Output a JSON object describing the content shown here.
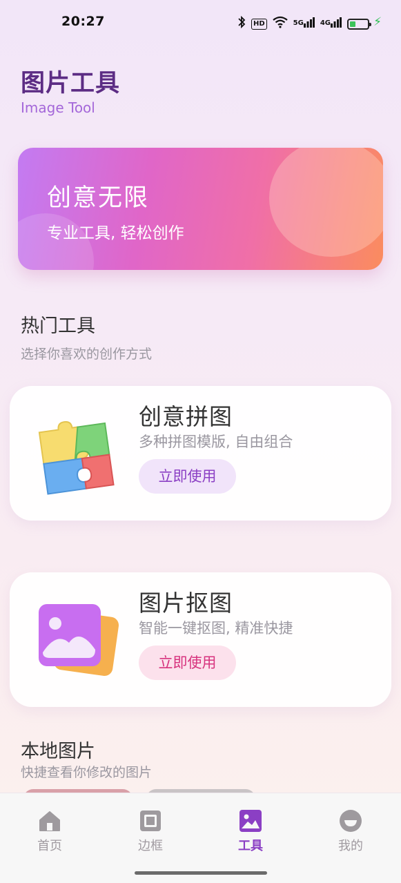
{
  "status_bar": {
    "time": "20:27",
    "icons": [
      "bluetooth-icon",
      "hd-icon",
      "wifi-icon",
      "5g-signal-icon",
      "4g-signal-icon",
      "battery-icon",
      "charging-icon"
    ],
    "hd_label": "HD",
    "signal_5g": "5G",
    "signal_4g": "4G",
    "battery_color": "#3CC35A"
  },
  "header": {
    "title": "图片工具",
    "subtitle": "Image Tool"
  },
  "banner": {
    "title": "创意无限",
    "subtitle": "专业工具, 轻松创作"
  },
  "hot_tools": {
    "title": "热门工具",
    "subtitle": "选择你喜欢的创作方式",
    "cards": [
      {
        "title": "创意拼图",
        "description": "多种拼图模版, 自由组合",
        "button": "立即使用",
        "icon": "puzzle-icon"
      },
      {
        "title": "图片抠图",
        "description": "智能一键抠图, 精准快捷",
        "button": "立即使用",
        "icon": "image-cutout-icon"
      }
    ]
  },
  "local_images": {
    "title": "本地图片",
    "subtitle": "快捷查看你修改的图片"
  },
  "nav": {
    "items": [
      {
        "label": "首页",
        "icon": "home-icon"
      },
      {
        "label": "边框",
        "icon": "frame-icon"
      },
      {
        "label": "工具",
        "icon": "image-tool-icon",
        "active": true
      },
      {
        "label": "我的",
        "icon": "profile-icon"
      }
    ],
    "active_color": "#8B3FC4"
  }
}
